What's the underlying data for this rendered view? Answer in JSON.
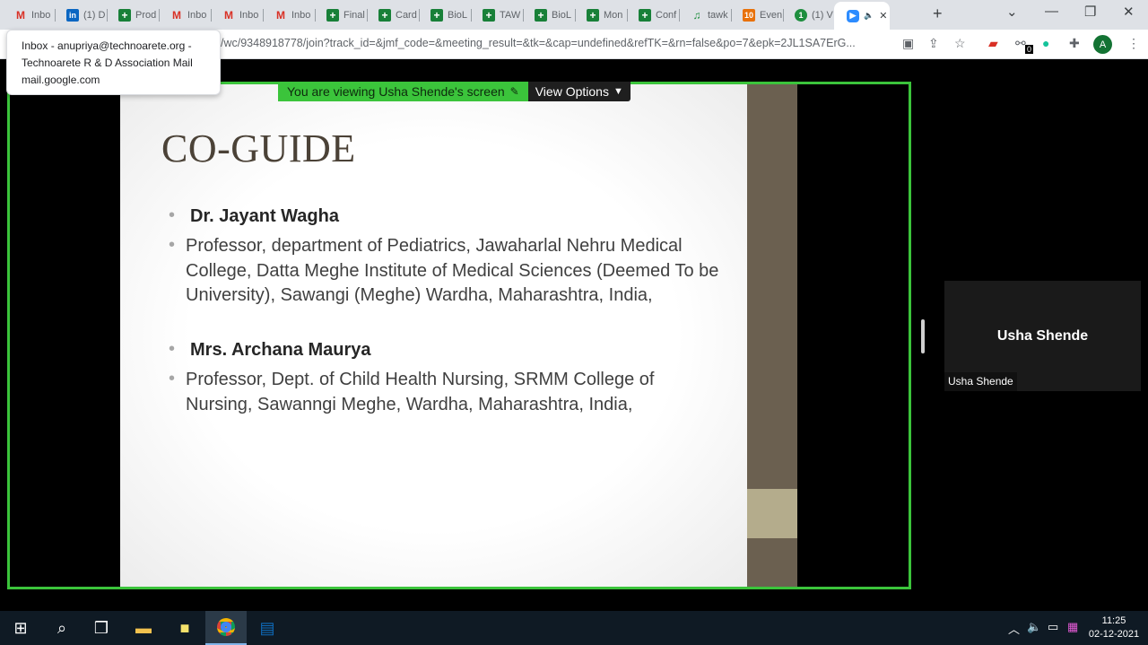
{
  "browser": {
    "tabs": [
      {
        "label": "Inbo",
        "icon": "gmail-icon"
      },
      {
        "label": "(1) D",
        "icon": "linkedin-icon"
      },
      {
        "label": "Prod",
        "icon": "sheets-icon"
      },
      {
        "label": "Inbo",
        "icon": "gmail-icon"
      },
      {
        "label": "Inbo",
        "icon": "gmail-icon"
      },
      {
        "label": "Inbo",
        "icon": "gmail-icon"
      },
      {
        "label": "Final",
        "icon": "sheets-icon"
      },
      {
        "label": "Card",
        "icon": "sheets-icon"
      },
      {
        "label": "BioL",
        "icon": "sheets-icon"
      },
      {
        "label": "TAW",
        "icon": "sheets-icon"
      },
      {
        "label": "BioL",
        "icon": "sheets-icon"
      },
      {
        "label": "Mon",
        "icon": "sheets-icon"
      },
      {
        "label": "Conf",
        "icon": "sheets-icon"
      },
      {
        "label": "tawk",
        "icon": "tawk-icon"
      },
      {
        "label": "Even",
        "icon": "orange-10-icon",
        "badge": "10"
      },
      {
        "label": "(1) V",
        "icon": "green-circle-icon",
        "badge": "1"
      },
      {
        "label": "",
        "icon": "zoom-icon",
        "active": true
      }
    ],
    "url": "/wc/9348918778/join?track_id=&jmf_code=&meeting_result=&tk=&cap=undefined&refTK=&rn=false&po=7&epk=2JL1SA7ErG...",
    "extension_badge": "0",
    "profile_initial": "A"
  },
  "tooltip": {
    "line1": "Inbox - anupriya@technoarete.org -",
    "line2": "Technoarete R & D Association Mail",
    "line3": "mail.google.com"
  },
  "meeting": {
    "viewing_banner": "You are viewing Usha Shende's screen",
    "view_options_label": "View Options",
    "participant_name": "Usha Shende",
    "participant_tag": "Usha Shende"
  },
  "slide": {
    "title": "CO-GUIDE",
    "items": [
      {
        "text": "Dr. Jayant Wagha",
        "bold": true
      },
      {
        "text": "Professor, department of Pediatrics, Jawaharlal Nehru Medical College, Datta Meghe Institute of Medical Sciences (Deemed To be University), Sawangi (Meghe) Wardha, Maharashtra, India,",
        "bold": false
      },
      {
        "text": "Mrs. Archana Maurya",
        "bold": true
      },
      {
        "text": "Professor, Dept. of Child Health Nursing, SRMM College of Nursing, Sawanngi Meghe, Wardha, Maharashtra, India,",
        "bold": false
      }
    ]
  },
  "taskbar": {
    "time": "11:25",
    "date": "02-12-2021"
  },
  "colors": {
    "share_border": "#3bc43b",
    "slide_title": "#4b4237",
    "slide_band": "#6b6050"
  }
}
